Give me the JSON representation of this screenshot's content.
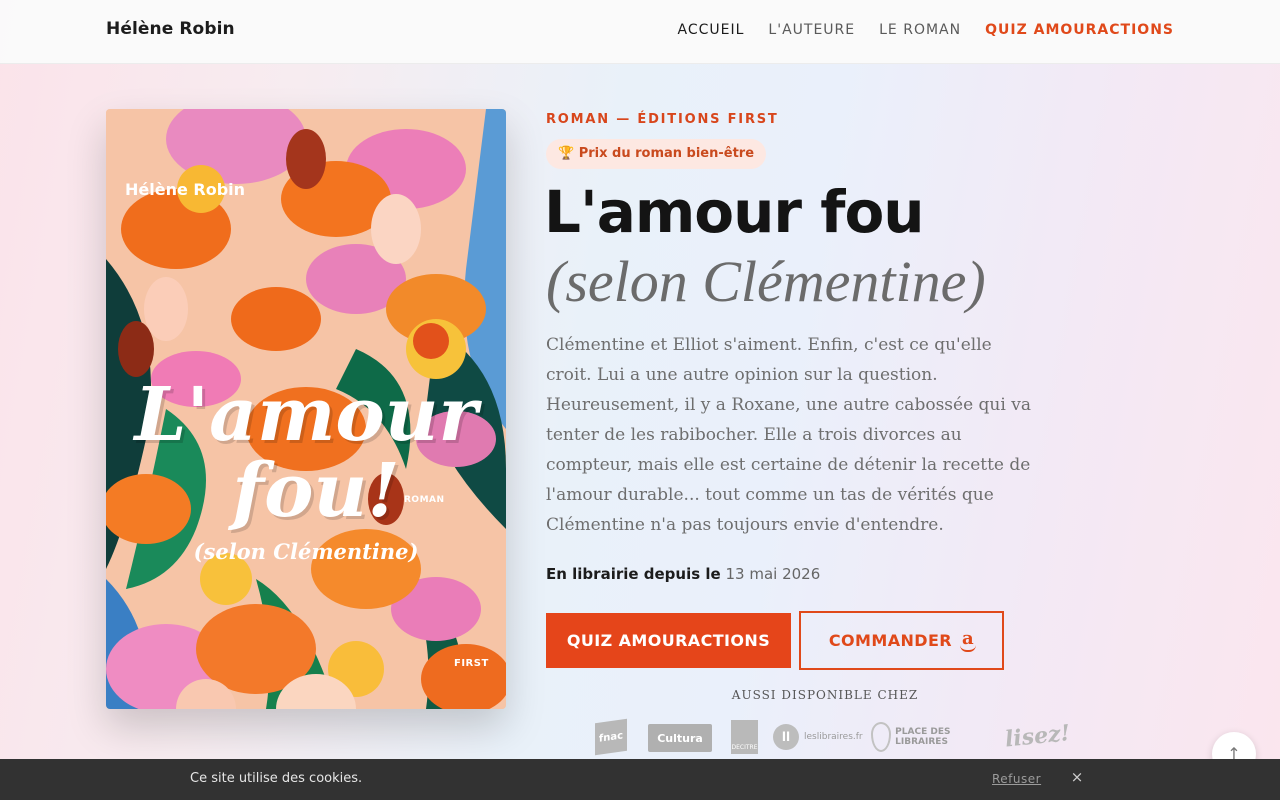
{
  "header": {
    "brand": "Hélène Robin",
    "nav": [
      {
        "label": "ACCUEIL"
      },
      {
        "label": "L'AUTEURE"
      },
      {
        "label": "LE ROMAN"
      },
      {
        "label": "QUIZ AMOURACTIONS"
      }
    ]
  },
  "cover": {
    "author": "Hélène Robin",
    "title_line1": "L'amour",
    "title_line2": "fou!",
    "subtitle": "(selon Clémentine)",
    "genre": "ROMAN",
    "publisher": "FIRST"
  },
  "hero": {
    "kicker": "ROMAN — ÉDITIONS FIRST",
    "award_icon": "trophy-icon",
    "award": "🏆 Prix du roman bien-être",
    "title": "L'amour fou",
    "subtitle": "(selon Clémentine)",
    "blurb": "Clémentine et Elliot s'aiment. Enfin, c'est ce qu'elle croit. Lui a une autre opinion sur la question. Heureusement, il y a Roxane, une autre cabossée qui va tenter de les rabibocher. Elle a trois divorces au compteur, mais elle est certaine de détenir la recette de l'amour durable... tout comme un tas de vérités que Clémentine n'a pas toujours envie d'entendre.",
    "release_label": "En librairie depuis le",
    "release_date": "13 mai 2026",
    "primary_button": "QUIZ AMOURACTIONS",
    "order_button": "COMMANDER",
    "order_icon": "amazon-icon",
    "also_available": "AUSSI DISPONIBLE CHEZ",
    "retailers": [
      {
        "name": "fnac"
      },
      {
        "name": "Cultura"
      },
      {
        "name": "DECITRE"
      },
      {
        "name": "leslibraires.fr"
      },
      {
        "name": "PLACE DES LIBRAIRES"
      },
      {
        "name": "lisez!"
      }
    ]
  },
  "cookie": {
    "text": "Ce site utilise des cookies.",
    "refuse": "Refuser",
    "close": "×"
  },
  "scroll_top": "↑",
  "colors": {
    "accent": "#e5451a",
    "ink": "#141414",
    "cookie_bar": "#323232"
  }
}
